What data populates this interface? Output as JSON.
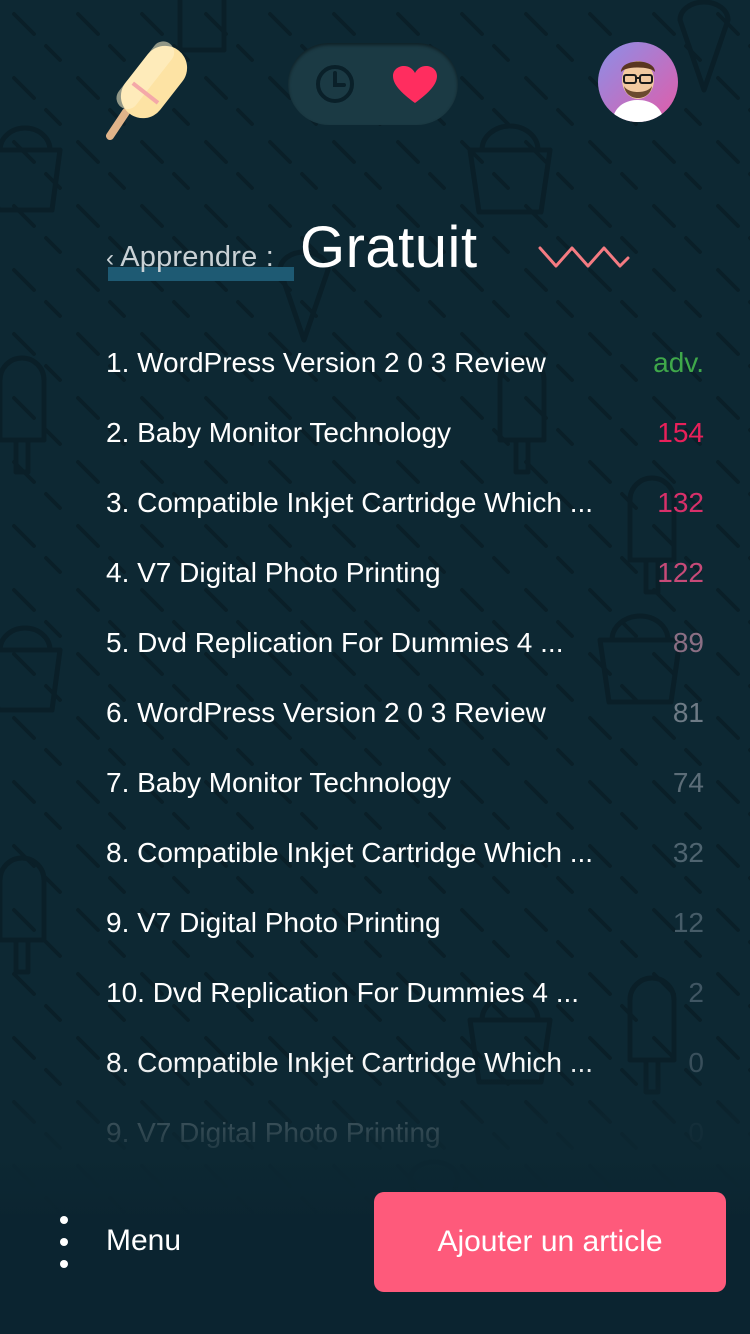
{
  "header": {
    "logo_icon": "popsicle-icon",
    "toggle": {
      "left_icon": "clock-icon",
      "right_icon": "heart-icon",
      "active": "heart"
    },
    "avatar_icon": "user-avatar-icon"
  },
  "heading": {
    "back_label": "Apprendre :",
    "back_icon": "chevron-left-icon",
    "title": "Gratuit",
    "decoration_icon": "zigzag-icon"
  },
  "articles": [
    {
      "title": "1. WordPress Version 2 0 3 Review",
      "count": "adv.",
      "color": "#3fa84a"
    },
    {
      "title": "2. Baby Monitor Technology",
      "count": "154",
      "color": "#e8205a"
    },
    {
      "title": "3. Compatible Inkjet Cartridge Which ...",
      "count": "132",
      "color": "#d8306a"
    },
    {
      "title": "4.  V7 Digital Photo Printing",
      "count": "122",
      "color": "#c74a78"
    },
    {
      "title": "5. Dvd Replication For Dummies 4 ...",
      "count": "89",
      "color": "#8b6f84"
    },
    {
      "title": "6.  WordPress Version 2 0 3 Review",
      "count": "81",
      "color": "#6e7b86"
    },
    {
      "title": "7. Baby Monitor Technology",
      "count": "74",
      "color": "#5c6d78"
    },
    {
      "title": "8. Compatible Inkjet Cartridge Which ...",
      "count": "32",
      "color": "#4f6470"
    },
    {
      "title": "9.  V7 Digital Photo Printing",
      "count": "12",
      "color": "#465c68"
    },
    {
      "title": "10. Dvd Replication For Dummies 4 ...",
      "count": "2",
      "color": "#405663"
    },
    {
      "title": "8. Compatible Inkjet Cartridge Which ...",
      "count": "0",
      "color": "#3a505c"
    },
    {
      "title": "9.  V7 Digital Photo Printing",
      "count": "0",
      "color": "#344a56"
    }
  ],
  "bottom_bar": {
    "menu_icon": "vertical-dots-icon",
    "menu_label": "Menu",
    "add_label": "Ajouter un article"
  },
  "colors": {
    "background": "#0d2833",
    "accent": "#fe5a7b",
    "heart": "#ff2d5f",
    "positive": "#3fa84a"
  }
}
